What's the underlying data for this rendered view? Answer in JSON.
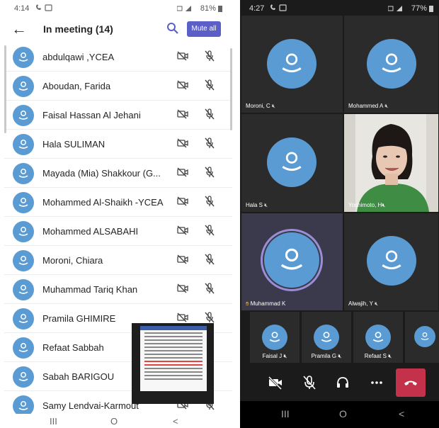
{
  "left_phone": {
    "status": {
      "time": "4:14",
      "battery": "81%"
    },
    "header": {
      "title": "In meeting (14)",
      "mute_all_label": "Mute all"
    },
    "participants": [
      "abdulqawi ,YCEA",
      "Aboudan, Farida",
      "Faisal Hassan Al Jehani",
      "Hala SULIMAN",
      "Mayada (Mia) Shakkour (G...",
      "Mohammed Al-Shaikh -YCEA",
      "Mohammed ALSABAHI",
      "Moroni, Chiara",
      "Muhammad Tariq Khan",
      "Pramila GHIMIRE",
      "Refaat Sabbah",
      "Sabah BARIGOU",
      "Samy Lendvai-Karmout"
    ],
    "nav": {
      "recents": "III",
      "home": "O",
      "back": "<"
    }
  },
  "right_phone": {
    "status": {
      "time": "4:27",
      "battery": "77%"
    },
    "tiles": [
      {
        "name": "Moroni, C"
      },
      {
        "name": "Mohammed A"
      },
      {
        "name": "Hala S"
      },
      {
        "name": "Yoshimoto, H"
      },
      {
        "name": "Muhammad K"
      },
      {
        "name": "Alwajih, Y"
      }
    ],
    "small_tiles": [
      {
        "name": "Faisal J"
      },
      {
        "name": "Pramila G"
      },
      {
        "name": "Refaat S"
      }
    ],
    "nav": {
      "recents": "III",
      "home": "O",
      "back": "<"
    }
  },
  "colors": {
    "accent": "#5b5fc7",
    "avatar": "#5a9bd4",
    "hangup": "#c4314b",
    "speaking_ring": "#9a8fd6"
  }
}
